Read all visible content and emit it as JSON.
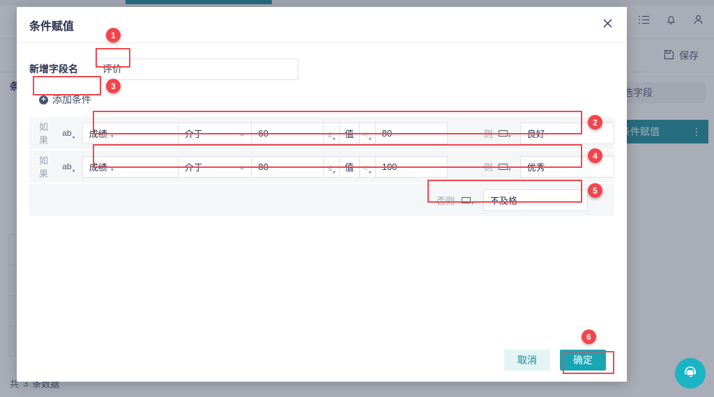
{
  "background": {
    "header_icons": [
      "list-icon",
      "bell-icon",
      "user-icon"
    ],
    "save_label": "保存",
    "save_icon": "floppy-disk-icon",
    "dropdown_caret": "caret-down-icon",
    "side_label": "条",
    "field_picker": "选字段",
    "active_item": "条件赋值",
    "item_menu": "⋮",
    "footer_prefix": "共",
    "footer_count": "3",
    "footer_suffix": "条数据",
    "chat_icon": "headset-support-icon"
  },
  "dialog": {
    "title": "条件赋值",
    "close_icon": "close-icon",
    "field_name_label": "新增字段名",
    "field_name_value": "评价",
    "add_condition_label": "添加条件",
    "add_condition_icon": "plus-circle-icon",
    "rows": [
      {
        "if_label": "如果",
        "type_icon": "ab",
        "field": "成绩",
        "operator": "介于",
        "lower_value": "60",
        "lower_op": "≤",
        "middle_label": "值",
        "upper_op": "<",
        "upper_value": "80",
        "then_label": "则",
        "result_type_icon": "text-field-icon",
        "result_value": "良好"
      },
      {
        "if_label": "如果",
        "type_icon": "ab",
        "field": "成绩",
        "operator": "介于",
        "lower_value": "80",
        "lower_op": "≤",
        "middle_label": "值",
        "upper_op": "<",
        "upper_value": "100",
        "then_label": "则",
        "result_type_icon": "text-field-icon",
        "result_value": "优秀"
      }
    ],
    "else_row": {
      "else_label": "否则",
      "result_type_icon": "text-field-icon",
      "result_value": "不及格"
    },
    "cancel_label": "取消",
    "confirm_label": "确定"
  },
  "annotations": {
    "badges": [
      "1",
      "2",
      "3",
      "4",
      "5",
      "6"
    ]
  },
  "colors": {
    "accent_teal": "#128a99",
    "button_teal": "#1aa5b4",
    "annotation_red": "#f4444c",
    "row_bg": "#f5f6f8"
  }
}
